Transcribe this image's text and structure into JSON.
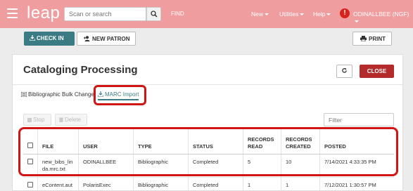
{
  "header": {
    "logo": "leap",
    "search_placeholder": "Scan or search",
    "find_label": "FIND",
    "nav": [
      {
        "label": "New"
      },
      {
        "label": "Utilities"
      },
      {
        "label": "Help"
      }
    ],
    "alert_glyph": "!",
    "user": "ODINALLBEE (NGF)",
    "colors": {
      "bar": "#f09da0",
      "alert": "#d9231d"
    }
  },
  "actions": {
    "check_in": "CHECK IN",
    "new_patron": "NEW PATRON",
    "print": "PRINT"
  },
  "panel": {
    "title": "Cataloging Processing",
    "close_label": "CLOSE",
    "tabs": [
      {
        "label": "Bibliographic Bulk Change",
        "active": false
      },
      {
        "label": "MARC Import",
        "active": true
      }
    ],
    "toolbar": {
      "stop": "Stop",
      "delete": "Delete",
      "filter_placeholder": "Filter"
    }
  },
  "table": {
    "headers": [
      "FILE",
      "USER",
      "TYPE",
      "STATUS",
      "RECORDS READ",
      "RECORDS CREATED",
      "POSTED"
    ],
    "rows": [
      {
        "file": "new_bibs_linda.mrc.txt",
        "user": "ODINALLBEE",
        "type": "Bibliographic",
        "status": "Completed",
        "read": "5",
        "created": "10",
        "posted": "7/14/2021 4:33:35 PM"
      },
      {
        "file": "eContent.aut",
        "user": "PolarisExec",
        "type": "Bibliographic",
        "status": "Completed",
        "read": "1",
        "created": "1",
        "posted": "7/12/2021 1:30:57 PM"
      }
    ]
  },
  "accent": "#3a7b84",
  "highlight_color": "#d01515"
}
